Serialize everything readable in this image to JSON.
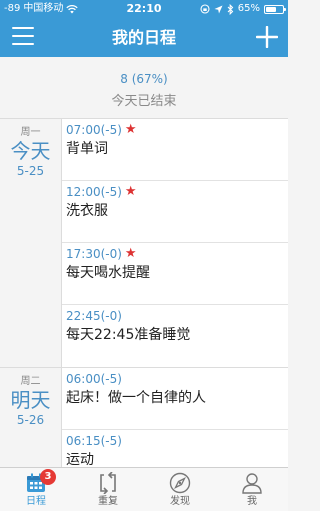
{
  "status_bar": {
    "signal": "-89",
    "carrier": "中国移动",
    "time": "22:10",
    "battery": "65%",
    "battery_level": 0.65
  },
  "nav": {
    "title": "我的日程"
  },
  "summary": {
    "count": "8 (67%)",
    "status": "今天已结束"
  },
  "days": [
    {
      "weekday": "周一",
      "label": "今天",
      "date": "5-25",
      "events": [
        {
          "time": "07:00(-5)",
          "starred": true,
          "title": "背单词"
        },
        {
          "time": "12:00(-5)",
          "starred": true,
          "title": "洗衣服"
        },
        {
          "time": "17:30(-0)",
          "starred": true,
          "title": "每天喝水提醒"
        },
        {
          "time": "22:45(-0)",
          "starred": false,
          "title": "每天22:45准备睡觉"
        }
      ]
    },
    {
      "weekday": "周二",
      "label": "明天",
      "date": "5-26",
      "events": [
        {
          "time": "06:00(-5)",
          "starred": false,
          "title": "起床！做一个自律的人"
        },
        {
          "time": "06:15(-5)",
          "starred": false,
          "title": "运动"
        }
      ]
    }
  ],
  "tabs": [
    {
      "label": "日程",
      "icon": "calendar-icon",
      "active": true,
      "badge": "3"
    },
    {
      "label": "重复",
      "icon": "repeat-icon",
      "active": false
    },
    {
      "label": "发现",
      "icon": "compass-icon",
      "active": false
    },
    {
      "label": "我",
      "icon": "person-icon",
      "active": false
    }
  ],
  "colors": {
    "primary": "#3a9ad6",
    "accent_text": "#4a8fc4",
    "star": "#dd3333",
    "badge": "#e53935"
  }
}
